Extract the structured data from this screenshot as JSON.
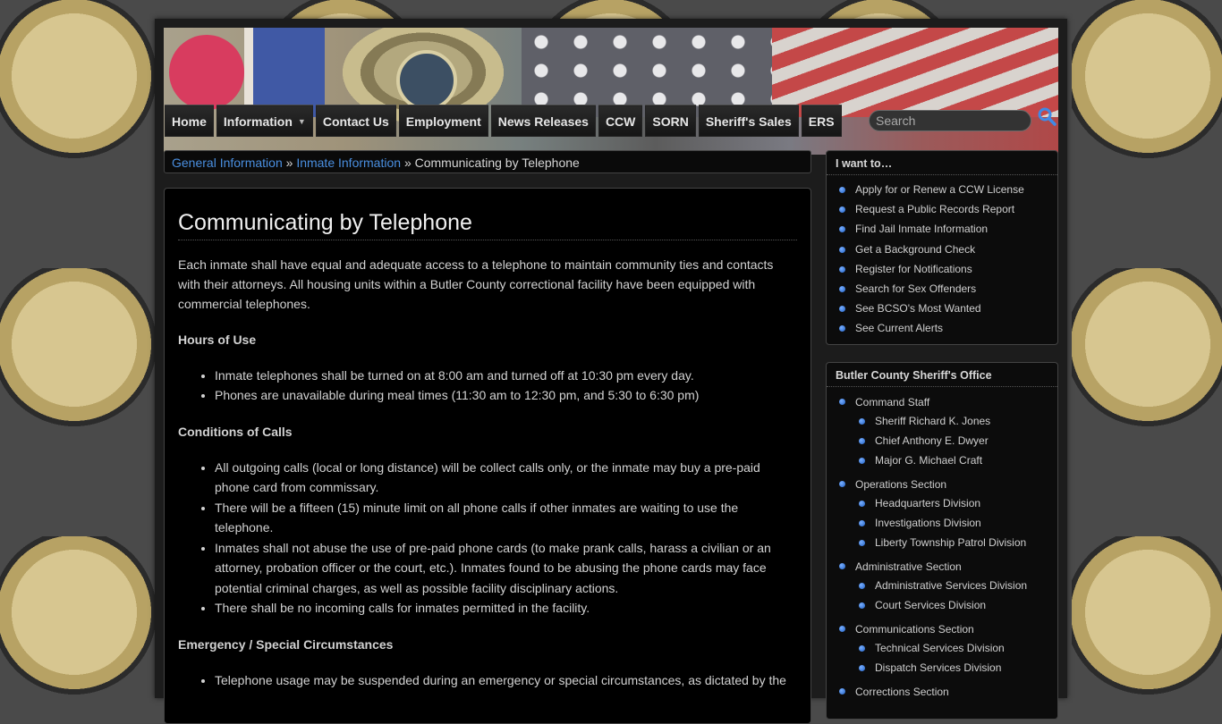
{
  "nav": {
    "items": [
      {
        "label": "Home"
      },
      {
        "label": "Information",
        "has_dropdown": true
      },
      {
        "label": "Contact Us"
      },
      {
        "label": "Employment"
      },
      {
        "label": "News Releases"
      },
      {
        "label": "CCW"
      },
      {
        "label": "SORN"
      },
      {
        "label": "Sheriff's Sales"
      },
      {
        "label": "ERS"
      }
    ],
    "search_placeholder": "Search"
  },
  "breadcrumb": {
    "link1": "General Information",
    "sep": "»",
    "link2": "Inmate Information",
    "current": "Communicating by Telephone"
  },
  "content": {
    "title": "Communicating by Telephone",
    "intro": "Each inmate shall have equal and adequate access to a telephone to maintain community ties and contacts with their attorneys. All housing units within a Butler County correctional facility have been equipped with commercial telephones.",
    "sections": [
      {
        "heading": "Hours of Use",
        "items": [
          "Inmate telephones shall be turned on at 8:00 am and turned off at 10:30 pm every day.",
          "Phones are unavailable during meal times (11:30 am to 12:30 pm, and 5:30 to 6:30 pm)"
        ]
      },
      {
        "heading": "Conditions of Calls",
        "items": [
          "All outgoing calls (local or long distance) will be collect calls only, or the inmate may buy a pre-paid phone card from commissary.",
          "There will be a fifteen (15) minute limit on all phone calls if other inmates are waiting to use the telephone.",
          "Inmates shall not abuse the use of pre-paid phone cards (to make prank calls, harass a civilian or an attorney, probation officer or the court, etc.). Inmates found to be abusing the phone cards may face potential criminal charges, as well as possible facility disciplinary actions.",
          "There shall be no incoming calls for inmates permitted in the facility."
        ]
      },
      {
        "heading": "Emergency / Special Circumstances",
        "items": [
          "Telephone usage may be suspended during an emergency or special circumstances, as dictated by the"
        ]
      }
    ]
  },
  "sidebar": {
    "want": {
      "title": "I want to…",
      "items": [
        "Apply for or Renew a CCW License",
        "Request a Public Records Report",
        "Find Jail Inmate Information",
        "Get a Background Check",
        "Register for Notifications",
        "Search for Sex Offenders",
        "See BCSO's Most Wanted",
        "See Current Alerts"
      ]
    },
    "office": {
      "title": "Butler County Sheriff's Office",
      "groups": [
        {
          "label": "Command Staff",
          "children": [
            "Sheriff Richard K. Jones",
            "Chief Anthony E. Dwyer",
            "Major G. Michael Craft"
          ]
        },
        {
          "label": "Operations Section",
          "children": [
            "Headquarters Division",
            "Investigations Division",
            "Liberty Township Patrol Division"
          ]
        },
        {
          "label": "Administrative Section",
          "children": [
            "Administrative Services Division",
            "Court Services Division"
          ]
        },
        {
          "label": "Communications Section",
          "children": [
            "Technical Services Division",
            "Dispatch Services Division"
          ]
        },
        {
          "label": "Corrections Section",
          "children": []
        }
      ]
    }
  }
}
